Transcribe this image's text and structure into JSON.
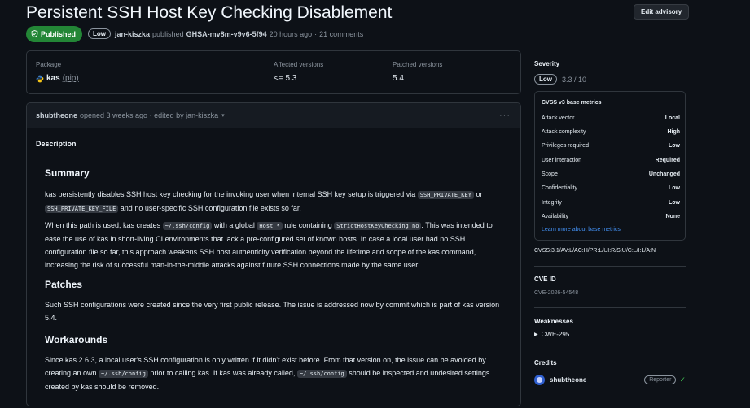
{
  "title": "Persistent SSH Host Key Checking Disablement",
  "edit_label": "Edit advisory",
  "meta": {
    "status": "Published",
    "severity": "Low",
    "author": "jan-kiszka",
    "published_word": "published",
    "ghsa": "GHSA-mv8m-v9v6-5f94",
    "time": "20 hours ago",
    "sep": "·",
    "comments": "21 comments"
  },
  "package": {
    "package_label": "Package",
    "name": "kas",
    "ecosystem": "(pip)",
    "affected_label": "Affected versions",
    "affected": "<= 5.3",
    "patched_label": "Patched versions",
    "patched": "5.4"
  },
  "comment": {
    "user": "shubtheone",
    "action": "opened 3 weeks ago · edited by jan-kiszka",
    "caret": "▾",
    "menu": "···",
    "description_label": "Description"
  },
  "content": {
    "summary_h": "Summary",
    "summary_p1_a": "kas persistently disables SSH host key checking for the invoking user when internal SSH key setup is triggered via ",
    "code_ssh_private_key": "SSH_PRIVATE_KEY",
    "summary_p1_b": " or ",
    "code_ssh_private_key_file": "SSH_PRIVATE_KEY_FILE",
    "summary_p1_c": " and no user-specific SSH configuration file exists so far.",
    "summary_p2_a": "When this path is used, kas creates ",
    "code_config": "~/.ssh/config",
    "summary_p2_b": " with a global ",
    "code_host": "Host *",
    "summary_p2_c": " rule containing ",
    "code_strict": "StrictHostKeyChecking no",
    "summary_p2_d": ". This was intended to ease the use of kas in short-living CI environments that lack a pre-configured set of known hosts. In case a local user had no SSH configuration file so far, this approach weakens SSH host authenticity verification beyond the lifetime and scope of the kas command, increasing the risk of successful man-in-the-middle attacks against future SSH connections made by the same user.",
    "patches_h": "Patches",
    "patches_p": "Such SSH configurations were created since the very first public release. The issue is addressed now by commit which is part of kas version 5.4.",
    "workarounds_h": "Workarounds",
    "work_p_a": "Since kas 2.6.3, a local user's SSH configuration is only written if it didn't exist before. From that version on, the issue can be avoided by creating an own ",
    "code_config2": "~/.ssh/config",
    "work_p_b": " prior to calling kas. If kas was already called, ",
    "code_config3": "~/.ssh/config",
    "work_p_c": " should be inspected and undesired settings created by kas should be removed."
  },
  "sidebar": {
    "severity_h": "Severity",
    "severity_level": "Low",
    "score": "3.3 / 10",
    "cvss_title": "CVSS v3 base metrics",
    "metrics": [
      {
        "k": "Attack vector",
        "v": "Local"
      },
      {
        "k": "Attack complexity",
        "v": "High"
      },
      {
        "k": "Privileges required",
        "v": "Low"
      },
      {
        "k": "User interaction",
        "v": "Required"
      },
      {
        "k": "Scope",
        "v": "Unchanged"
      },
      {
        "k": "Confidentiality",
        "v": "Low"
      },
      {
        "k": "Integrity",
        "v": "Low"
      },
      {
        "k": "Availability",
        "v": "None"
      }
    ],
    "learn_more": "Learn more about base metrics",
    "vector": "CVSS:3.1/AV:L/AC:H/PR:L/UI:R/S:U/C:L/I:L/A:N",
    "cve_h": "CVE ID",
    "cve": "CVE-2026-54548",
    "weak_h": "Weaknesses",
    "cwe": "CWE-295",
    "credits_h": "Credits",
    "credit_user": "shubtheone",
    "credit_role": "Reporter"
  },
  "colors": {
    "background": "#0d1117",
    "published_green": "#238636",
    "link_blue": "#4493f8",
    "check_green": "#3fb950"
  }
}
